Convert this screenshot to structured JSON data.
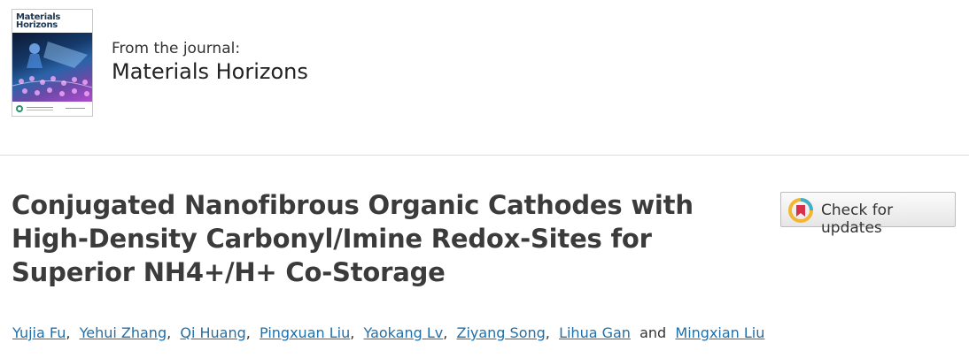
{
  "journal": {
    "cover_title_line1": "Materials",
    "cover_title_line2": "Horizons",
    "from_label": "From the journal:",
    "name": "Materials Horizons"
  },
  "article": {
    "title_lines": [
      "Conjugated Nanofibrous Organic Cathodes with",
      "High-Density Carbonyl/Imine Redox-Sites for",
      "Superior NH4+/H+ Co-Storage"
    ],
    "check_updates_label": "Check for updates",
    "authors": [
      "Yujia Fu",
      "Yehui Zhang",
      "Qi Huang",
      "Pingxuan Liu",
      "Yaokang Lv",
      "Ziyang Song",
      "Lihua Gan",
      "Mingxian Liu"
    ],
    "comma": ",",
    "and_word": "and"
  },
  "colors": {
    "link": "#1f6fa8",
    "title": "#3b3b3b",
    "divider": "#dddddd"
  }
}
